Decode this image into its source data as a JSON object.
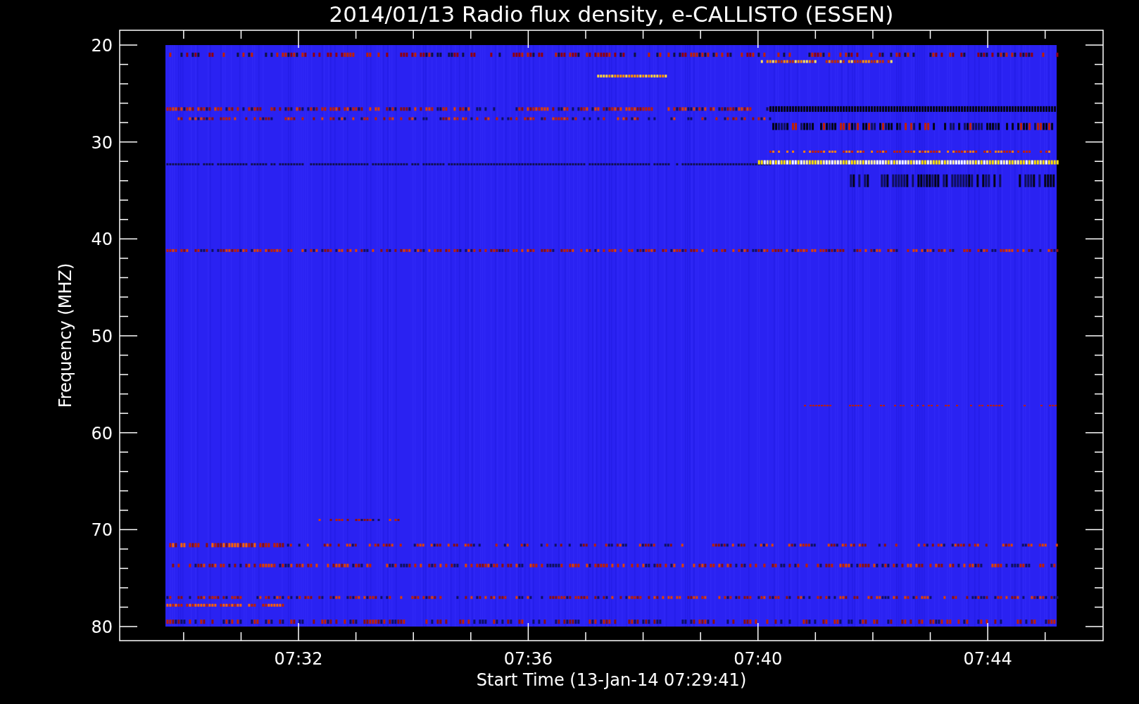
{
  "title": "2014/01/13  Radio flux density, e-CALLISTO (ESSEN)",
  "y_axis": {
    "label": "Frequency (MHZ)",
    "ticks": [
      "20",
      "30",
      "40",
      "50",
      "60",
      "70",
      "80"
    ]
  },
  "x_axis": {
    "label": "Start Time (13-Jan-14 07:29:41)",
    "ticks": [
      "07:32",
      "07:36",
      "07:40",
      "07:44"
    ]
  }
}
